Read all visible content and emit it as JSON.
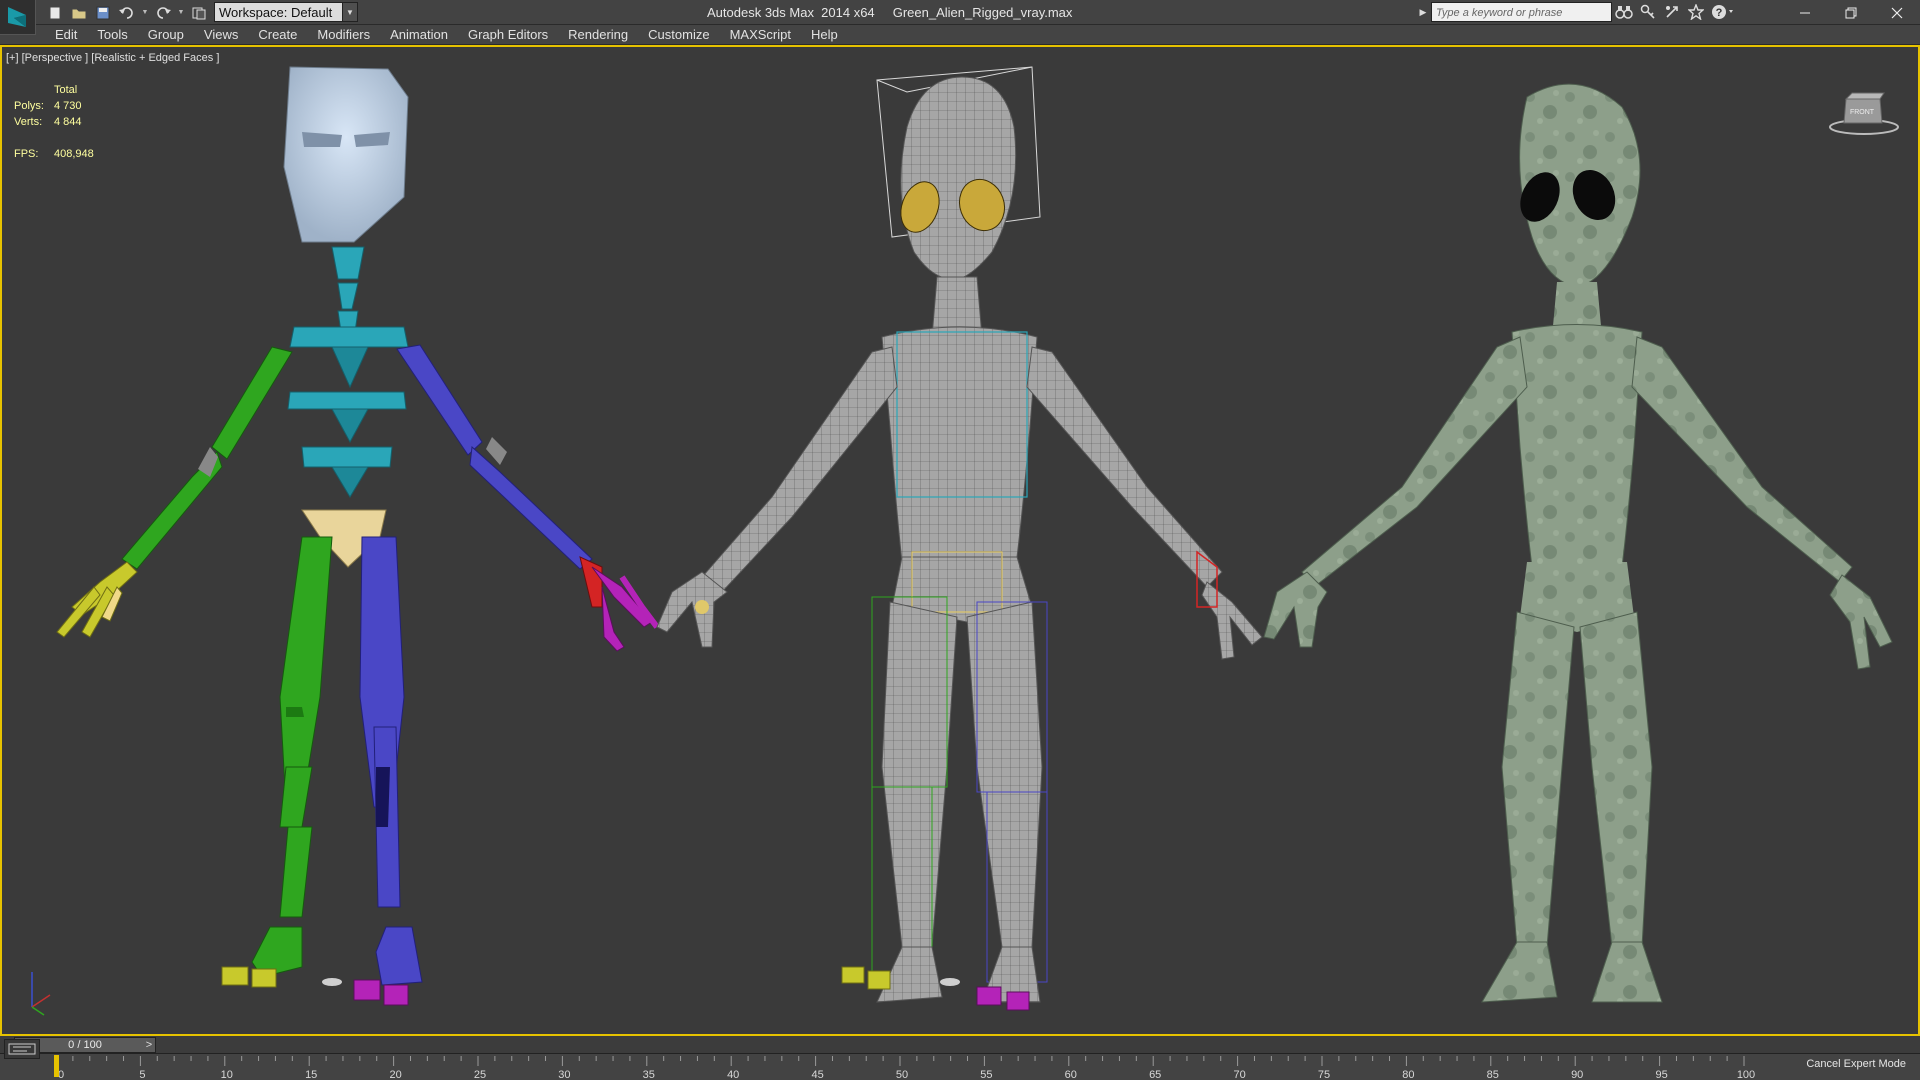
{
  "titlebar": {
    "workspace_label": "Workspace: Default",
    "title": "Autodesk 3ds Max  2014 x64     Green_Alien_Rigged_vray.max",
    "search_placeholder": "Type a keyword or phrase"
  },
  "menu": {
    "items": [
      "Edit",
      "Tools",
      "Group",
      "Views",
      "Create",
      "Modifiers",
      "Animation",
      "Graph Editors",
      "Rendering",
      "Customize",
      "MAXScript",
      "Help"
    ]
  },
  "viewport": {
    "label": "[+] [Perspective ] [Realistic + Edged Faces ]",
    "stats": {
      "header": "Total",
      "polys_label": "Polys:",
      "polys_value": "4 730",
      "verts_label": "Verts:",
      "verts_value": "4 844",
      "fps_label": "FPS:",
      "fps_value": "408,948"
    },
    "viewcube_label": "FRONT"
  },
  "timeline": {
    "frame_display": "0 / 100",
    "prev_label": "<",
    "next_label": ">",
    "ticks": [
      "0",
      "5",
      "10",
      "15",
      "20",
      "25",
      "30",
      "35",
      "40",
      "45",
      "50",
      "55",
      "60",
      "65",
      "70",
      "75",
      "80",
      "85",
      "90",
      "95",
      "100"
    ],
    "cancel_expert": "Cancel Expert Mode"
  },
  "colors": {
    "accent_border": "#e6c200",
    "skeleton_cyan": "#2aa6b8",
    "skeleton_green": "#2fa61f",
    "skeleton_blue": "#4a47c6",
    "alien_skin": "#8fa08c"
  }
}
